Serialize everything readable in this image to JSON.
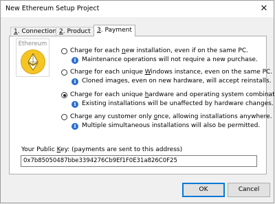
{
  "window": {
    "title": "New Ethereum Setup Project",
    "close_glyph": "✕"
  },
  "tabs": [
    {
      "underline": "1",
      "rest": ". Connection",
      "active": false
    },
    {
      "underline": "2",
      "rest": ". Product",
      "active": false
    },
    {
      "underline": "3",
      "rest": ". Payment",
      "active": true
    }
  ],
  "logo": {
    "label": "Ethereum",
    "icon": "ethereum-coin-icon",
    "color": "#f5c623"
  },
  "options": [
    {
      "pre": "Charge for each ",
      "key": "n",
      "post": "ew installation, even if on the same PC.",
      "note": "Maintenance operations will not require a new purchase.",
      "selected": false
    },
    {
      "pre": "Charge for each unique ",
      "key": "W",
      "post": "indows instance, even on the same PC.",
      "note": "Cloned images, even on new hardware, will accept reinstalls.",
      "selected": false
    },
    {
      "pre": "Charge for each unique ",
      "key": "h",
      "post": "ardware and operating system combination.",
      "note": "Existing installations will be unaffected by hardware changes.",
      "selected": true
    },
    {
      "pre": "Charge any customer only ",
      "key": "o",
      "post": "nce, allowing installations anywhere.",
      "note": "Multiple simultaneous installations will also be permitted.",
      "selected": false
    }
  ],
  "key": {
    "label_pre": "Your Public ",
    "label_key": "K",
    "label_post": "ey: (payments are sent to this address)",
    "value": "0x7b85050487bbe3394276Cb9Ef1F0E31a826C0F25"
  },
  "buttons": {
    "ok": "OK",
    "cancel": "Cancel"
  },
  "info_glyph": "i"
}
